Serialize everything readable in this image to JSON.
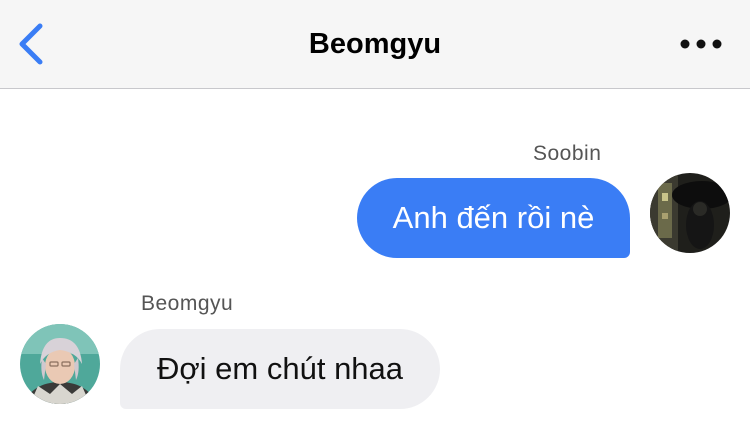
{
  "header": {
    "title": "Beomgyu",
    "back_icon": "chevron-left-icon",
    "more_icon": "more-horizontal-icon",
    "accent_color": "#3a7df5"
  },
  "messages": [
    {
      "sender": "Soobin",
      "text": "Anh đến rồi nè",
      "direction": "outgoing",
      "bubble_color": "#3a7df5"
    },
    {
      "sender": "Beomgyu",
      "text": "Đợi em chút nhaa",
      "direction": "incoming",
      "bubble_color": "#efeff2"
    }
  ]
}
